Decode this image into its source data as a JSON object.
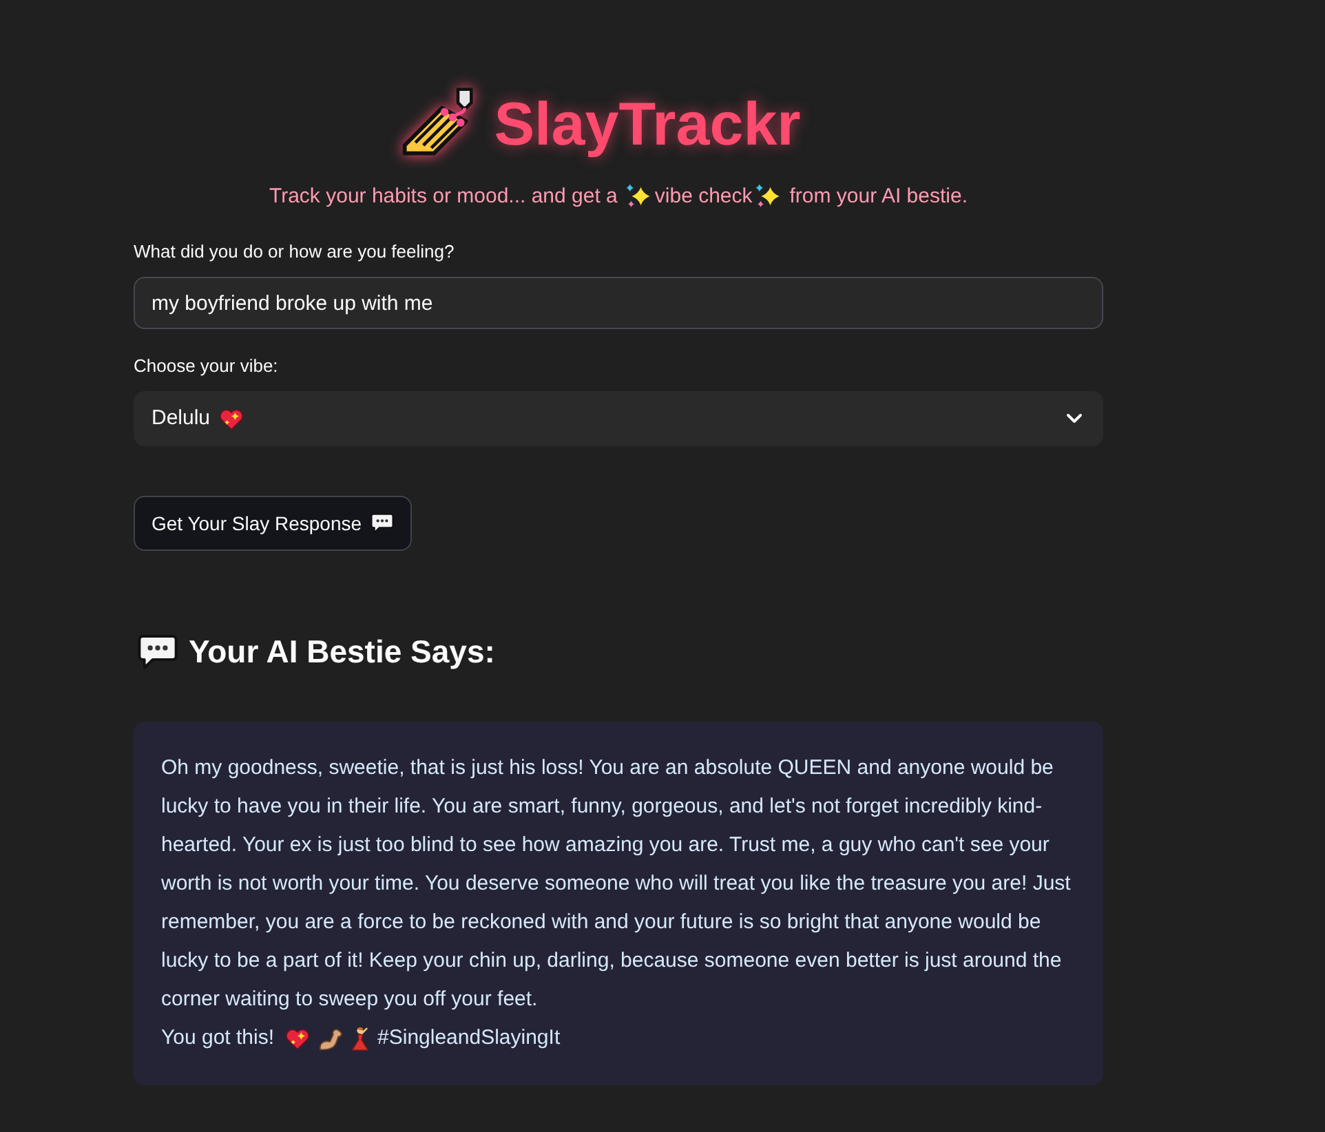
{
  "header": {
    "title": "SlayTrackr",
    "subtitle_parts": [
      "Track your habits or mood... and get a",
      "vibe check",
      "from your AI bestie."
    ]
  },
  "mood_input": {
    "label": "What did you do or how are you feeling?",
    "value": "my boyfriend broke up with me"
  },
  "vibe_select": {
    "label": "Choose your vibe:",
    "value": "Delulu"
  },
  "submit_button": {
    "label": "Get Your Slay Response"
  },
  "response": {
    "heading": "Your AI Bestie Says:",
    "message": "Oh my goodness, sweetie, that is just his loss! You are an absolute QUEEN and anyone would be lucky to have you in their life. You are smart, funny, gorgeous, and let's not forget incredibly kind-hearted. Your ex is just too blind to see how amazing you are. Trust me, a guy who can't see your worth is not worth your time. You deserve someone who will treat you like the treasure you are! Just remember, you are a force to be reckoned with and your future is so bright that anyone would be lucky to be a part of it! Keep your chin up, darling, because someone even better is just around the corner waiting to sweep you off your feet.",
    "closing": "You got this!",
    "hashtag": "#SingleandSlayingIt"
  }
}
